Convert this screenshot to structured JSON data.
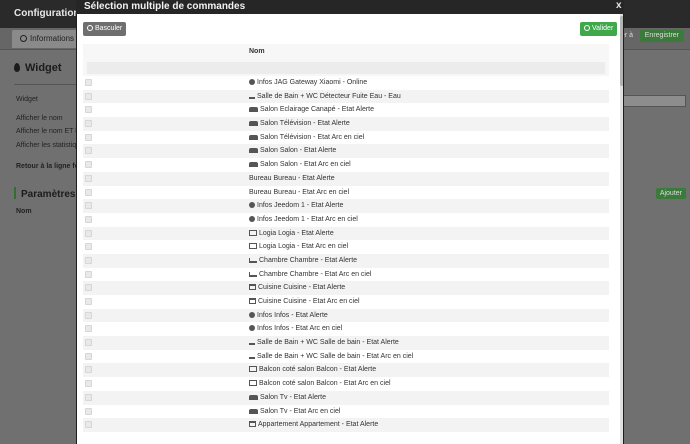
{
  "background": {
    "page_title": "Configuration co",
    "tab_informations": "Informations",
    "delete_btn": "quer à",
    "save_btn": "Enregistrer",
    "widget_title": "Widget",
    "widget_label": "Widget",
    "show_name": "Afficher le nom",
    "show_name_and": "Afficher le nom ET l'i",
    "show_stats": "Afficher les statistiqu",
    "back_line": "Retour à la ligne fo",
    "params_title": "Paramètres opt",
    "add_btn": "Ajouter",
    "name_col": "Nom"
  },
  "modal": {
    "title": "Sélection multiple de commandes",
    "close": "x",
    "toggle_label": "Basculer",
    "validate_label": "Valider",
    "column_header": "Nom",
    "rows": [
      {
        "icon": "info",
        "label": "Infos JAG Gateway Xiaomi - Online"
      },
      {
        "icon": "bath",
        "label": "Salle de Bain + WC Détecteur Fuite Eau - Eau"
      },
      {
        "icon": "sofa",
        "label": "Salon Eclairage Canapé - Etat Alerte"
      },
      {
        "icon": "sofa",
        "label": "Salon Télévision - Etat Alerte"
      },
      {
        "icon": "sofa",
        "label": "Salon Télévision - Etat Arc en ciel"
      },
      {
        "icon": "sofa",
        "label": "Salon Salon - Etat Alerte"
      },
      {
        "icon": "sofa",
        "label": "Salon Salon - Etat Arc en ciel"
      },
      {
        "icon": "none",
        "label": "Bureau Bureau - Etat Alerte"
      },
      {
        "icon": "none",
        "label": "Bureau Bureau - Etat Arc en ciel"
      },
      {
        "icon": "info",
        "label": "Infos Jeedom 1 - Etat Alerte"
      },
      {
        "icon": "info",
        "label": "Infos Jeedom 1 - Etat Arc en ciel"
      },
      {
        "icon": "tv",
        "label": "Logia Logia - Etat Alerte"
      },
      {
        "icon": "tv",
        "label": "Logia Logia - Etat Arc en ciel"
      },
      {
        "icon": "bed",
        "label": "Chambre Chambre - Etat Alerte"
      },
      {
        "icon": "bed",
        "label": "Chambre Chambre - Etat Arc en ciel"
      },
      {
        "icon": "kitchen",
        "label": "Cuisine Cuisine - Etat Alerte"
      },
      {
        "icon": "kitchen",
        "label": "Cuisine Cuisine - Etat Arc en ciel"
      },
      {
        "icon": "info",
        "label": "Infos Infos - Etat Alerte"
      },
      {
        "icon": "info",
        "label": "Infos Infos - Etat Arc en ciel"
      },
      {
        "icon": "bath",
        "label": "Salle de Bain + WC Salle de bain - Etat Alerte"
      },
      {
        "icon": "bath",
        "label": "Salle de Bain + WC Salle de bain - Etat Arc en ciel"
      },
      {
        "icon": "tv",
        "label": "Balcon coté salon Balcon - Etat Alerte"
      },
      {
        "icon": "tv",
        "label": "Balcon coté salon Balcon - Etat Arc en ciel"
      },
      {
        "icon": "sofa",
        "label": "Salon Tv - Etat Alerte"
      },
      {
        "icon": "sofa",
        "label": "Salon Tv - Etat Arc en ciel"
      },
      {
        "icon": "kitchen",
        "label": "Appartement Appartement - Etat Alerte"
      }
    ]
  },
  "colors": {
    "validate": "#3ea84a",
    "toggle": "#6f6f6f",
    "header_dark": "#262626"
  }
}
